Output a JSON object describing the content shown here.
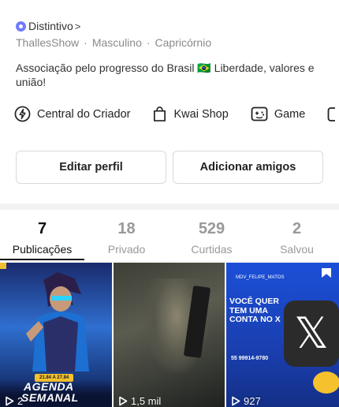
{
  "profile": {
    "badge_label": "Distintivo",
    "badge_chevron": ">",
    "meta": [
      "ThallesShow",
      "Masculino",
      "Capricórnio"
    ],
    "meta_separator": "·",
    "bio": "Associação pelo progresso do Brasil 🇧🇷 Liberdade, valores e união!"
  },
  "links": [
    {
      "label": "Central do Criador",
      "icon": "lightning-circle-icon"
    },
    {
      "label": "Kwai Shop",
      "icon": "shopping-bag-icon"
    },
    {
      "label": "Game",
      "icon": "gamepad-icon"
    }
  ],
  "buttons": {
    "edit_label": "Editar perfil",
    "add_label": "Adicionar amigos"
  },
  "tabs": [
    {
      "count": "7",
      "label": "Publicações",
      "active": true
    },
    {
      "count": "18",
      "label": "Privado",
      "active": false
    },
    {
      "count": "529",
      "label": "Curtidas",
      "active": false
    },
    {
      "count": "2",
      "label": "Salvou",
      "active": false
    }
  ],
  "posts": [
    {
      "views": "2",
      "banner_line1": "AGENDA",
      "banner_line2": "SEMANAL",
      "date_text": "21.84 A 27.84"
    },
    {
      "views": "1,5 mil"
    },
    {
      "views": "927",
      "handle": "MDV_FELIPE_MATOS",
      "headline": "VOCÊ QUER TEM UMA CONTA NO X",
      "x_logo": "𝕏",
      "phone": "55 99914-9780"
    }
  ],
  "colors": {
    "accent_badge": "#6f7cff",
    "active_tab": "#111111",
    "inactive_tab": "#999999"
  }
}
